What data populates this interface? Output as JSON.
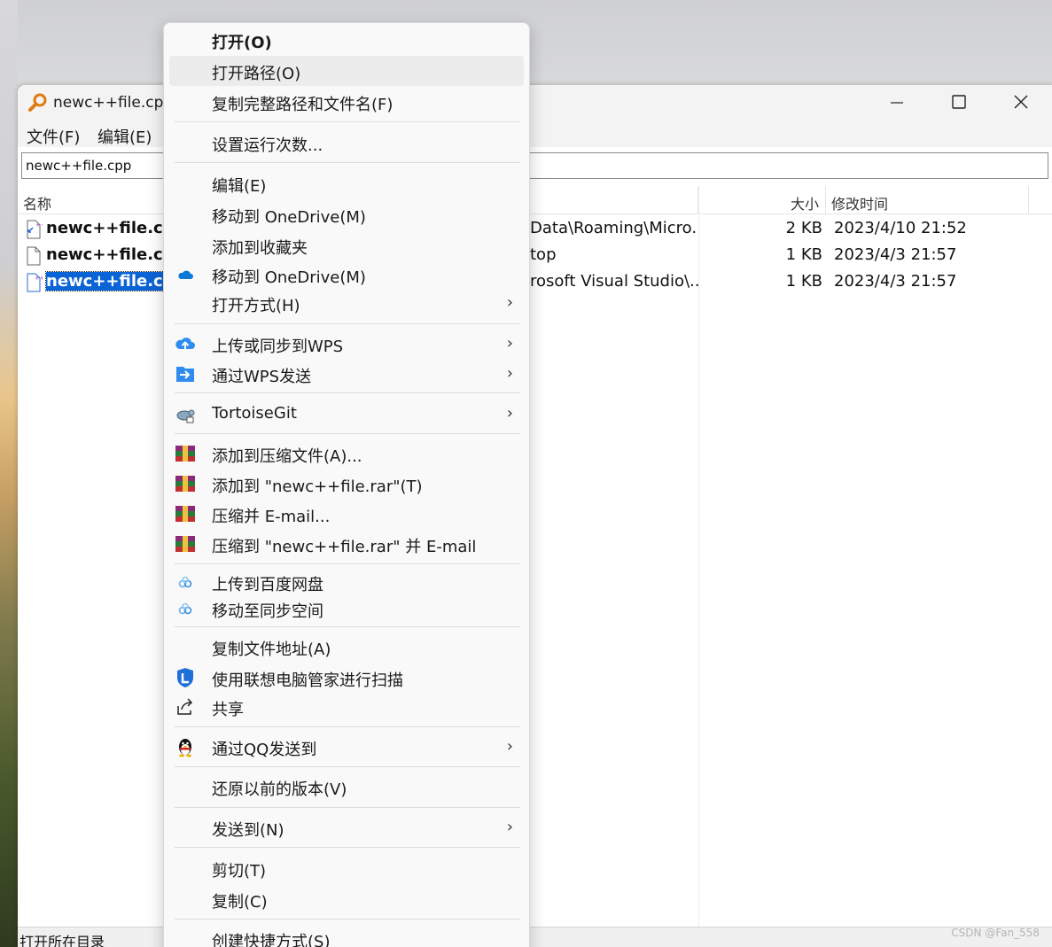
{
  "window": {
    "title": "newc++file.cpp",
    "menu": [
      "文件(F)",
      "编辑(E)"
    ],
    "search_value": "newc++file.cpp",
    "columns": {
      "name": "名称",
      "size": "大小",
      "modified": "修改时间"
    },
    "files": [
      {
        "name": "newc++file.cpp",
        "path": "Data\\Roaming\\Micro...",
        "size": "2 KB",
        "modified": "2023/4/10 21:52"
      },
      {
        "name": "newc++file.cpp",
        "path": "top",
        "size": "1 KB",
        "modified": "2023/4/3 21:57"
      },
      {
        "name": "newc++file.cpp",
        "path": "rosoft Visual Studio\\...",
        "size": "1 KB",
        "modified": "2023/4/3 21:57"
      }
    ],
    "status": "打开所在目录",
    "controls": {
      "minimize": "minimize-icon",
      "maximize": "maximize-icon",
      "close": "close-icon"
    }
  },
  "context_menu": {
    "items": [
      {
        "label": "打开(O)",
        "bold": true
      },
      {
        "label": "打开路径(O)",
        "hover": true
      },
      {
        "label": "复制完整路径和文件名(F)"
      },
      {
        "label": "设置运行次数..."
      },
      {
        "label": "编辑(E)"
      },
      {
        "label": "移动到 OneDrive(M)"
      },
      {
        "label": "添加到收藏夹"
      },
      {
        "label": "移动到 OneDrive(M)",
        "icon": "onedrive-cloud-icon"
      },
      {
        "label": "打开方式(H)",
        "submenu": true
      },
      {
        "label": "上传或同步到WPS",
        "icon": "wps-cloud-upload-icon",
        "submenu": true
      },
      {
        "label": "通过WPS发送",
        "icon": "wps-send-icon",
        "submenu": true
      },
      {
        "label": "TortoiseGit",
        "icon": "tortoisegit-icon",
        "submenu": true
      },
      {
        "label": "添加到压缩文件(A)...",
        "icon": "winrar-icon"
      },
      {
        "label": "添加到 \"newc++file.rar\"(T)",
        "icon": "winrar-icon"
      },
      {
        "label": "压缩并 E-mail...",
        "icon": "winrar-icon"
      },
      {
        "label": "压缩到 \"newc++file.rar\" 并 E-mail",
        "icon": "winrar-icon"
      },
      {
        "label": "上传到百度网盘",
        "icon": "baidu-netdisk-icon"
      },
      {
        "label": "移动至同步空间",
        "icon": "baidu-netdisk-icon"
      },
      {
        "label": "复制文件地址(A)"
      },
      {
        "label": "使用联想电脑管家进行扫描",
        "icon": "lenovo-shield-icon"
      },
      {
        "label": "共享",
        "icon": "share-icon"
      },
      {
        "label": "通过QQ发送到",
        "icon": "qq-penguin-icon",
        "submenu": true
      },
      {
        "label": "还原以前的版本(V)"
      },
      {
        "label": "发送到(N)",
        "submenu": true
      },
      {
        "label": "剪切(T)"
      },
      {
        "label": "复制(C)"
      },
      {
        "label": "创建快捷方式(S)"
      }
    ],
    "submenu_arrow": "›"
  },
  "watermark": "CSDN @Fan_558",
  "colors": {
    "selection": "#0a64d6",
    "menu_bg": "#f9f9f9",
    "hover": "#ececec"
  }
}
